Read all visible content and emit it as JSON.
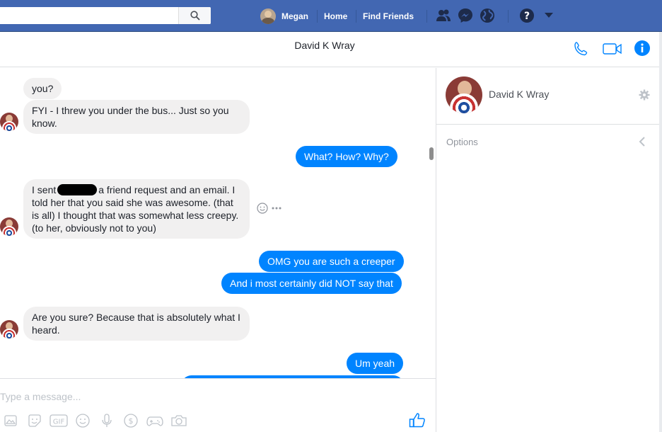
{
  "nav": {
    "user_name": "Megan",
    "home": "Home",
    "find_friends": "Find Friends"
  },
  "conversation": {
    "title": "David K Wray"
  },
  "messages": [
    {
      "dir": "in",
      "text": "you?"
    },
    {
      "dir": "in",
      "text": "FYI - I threw you under the bus... Just so you know."
    },
    {
      "dir": "out",
      "text": "What?  How?  Why?"
    },
    {
      "dir": "in",
      "text_a": "I sent",
      "text_b": "a friend request and an email. I told her that you said she was awesome. (that is all) I thought that was somewhat less creepy. (to her, obviously not to you)"
    },
    {
      "dir": "out",
      "text": "OMG you are such a creeper"
    },
    {
      "dir": "out",
      "text": "And i most certainly did NOT say that"
    },
    {
      "dir": "in",
      "text": "Are you sure? Because that is absolutely what I heard."
    },
    {
      "dir": "out",
      "text": "Um yeah"
    }
  ],
  "composer": {
    "placeholder": "Type a message...",
    "gif_label": "GIF"
  },
  "profile": {
    "name": "David K Wray",
    "options_label": "Options"
  },
  "colors": {
    "brand": "#4267b2",
    "outgoing": "#0084ff",
    "incoming": "#f1f0f0"
  }
}
